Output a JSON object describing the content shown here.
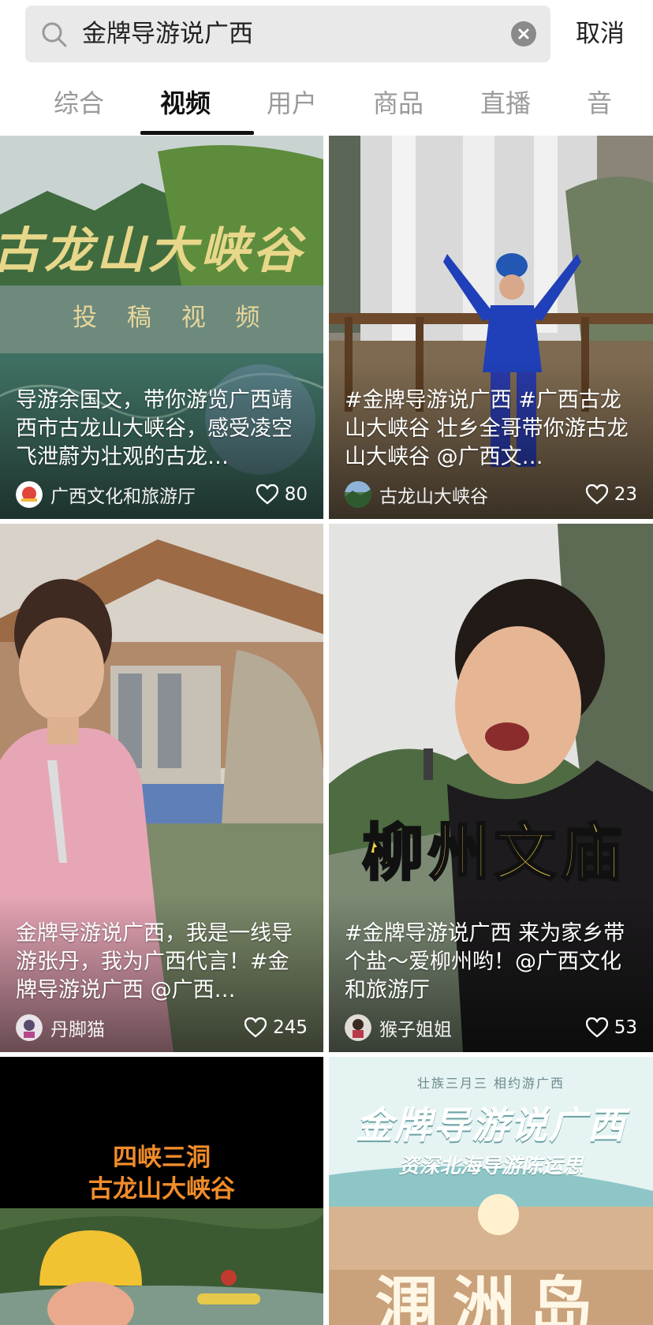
{
  "search": {
    "query": "金牌导游说广西",
    "cancel_label": "取消"
  },
  "tabs": [
    {
      "label": "综合"
    },
    {
      "label": "视频"
    },
    {
      "label": "用户"
    },
    {
      "label": "商品"
    },
    {
      "label": "直播"
    },
    {
      "label": "音"
    }
  ],
  "cards": [
    {
      "title": "导游余国文，带你游览广西靖西市古龙山大峡谷，感受凌空飞泄蔚为壮观的古龙…",
      "author": "广西文化和旅游厅",
      "likes": "80",
      "overlay": [
        "古龙山大峡谷",
        "投 稿 视 频"
      ]
    },
    {
      "title": "#金牌导游说广西 #广西古龙山大峡谷 壮乡全哥带你游古龙山大峡谷 @广西文…",
      "author": "古龙山大峡谷",
      "likes": "23",
      "overlay": []
    },
    {
      "title": "金牌导游说广西，我是一线导游张丹，我为广西代言！#金牌导游说广西 @广西…",
      "author": "丹脚猫",
      "likes": "245",
      "overlay": []
    },
    {
      "title": "#金牌导游说广西 来为家乡带个盐～爱柳州哟！@广西文化和旅游厅",
      "author": "猴子姐姐",
      "likes": "53",
      "overlay": [
        "柳州文庙"
      ]
    },
    {
      "title": "",
      "author": "",
      "likes": "",
      "overlay": [
        "四峡三洞",
        "古龙山大峡谷"
      ]
    },
    {
      "title": "",
      "author": "",
      "likes": "",
      "overlay": [
        "壮族三月三 相约游广西",
        "金牌导游说广西",
        "资深北海导游陈运思",
        "涠洲岛"
      ]
    }
  ],
  "colors": {
    "accent": "#111111",
    "inactive_tab": "#9a9a9a",
    "search_bg": "#e9e9e9"
  }
}
